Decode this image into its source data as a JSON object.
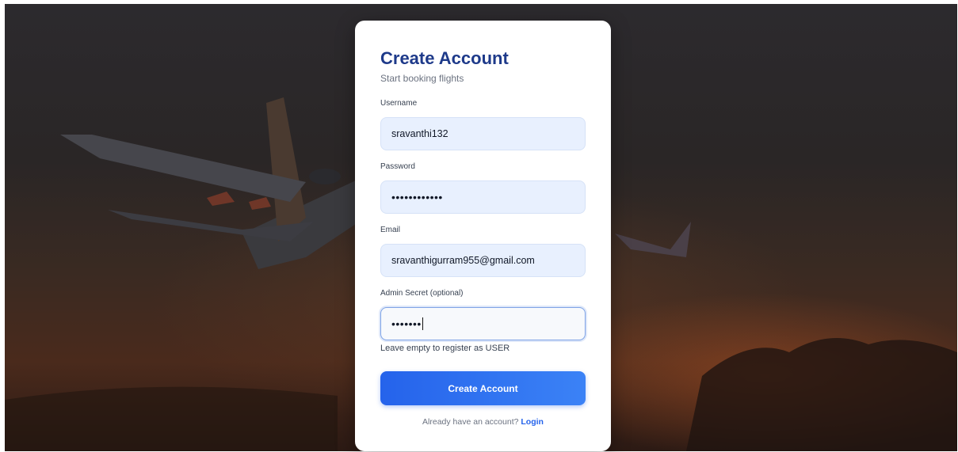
{
  "form": {
    "title": "Create Account",
    "subtitle": "Start booking flights",
    "username_label": "Username",
    "username_value": "sravanthi132",
    "password_label": "Password",
    "password_masked": "••••••••••••",
    "email_label": "Email",
    "email_value": "sravanthigurram955@gmail.com",
    "admin_label": "Admin Secret (optional)",
    "admin_masked": "•••••••",
    "admin_hint": "Leave empty to register as USER",
    "submit_label": "Create Account",
    "footer_text": "Already have an account?",
    "login_link": "Login"
  },
  "colors": {
    "title": "#1e3a8a",
    "accent": "#2563eb",
    "input_bg": "#e8f0fe"
  }
}
